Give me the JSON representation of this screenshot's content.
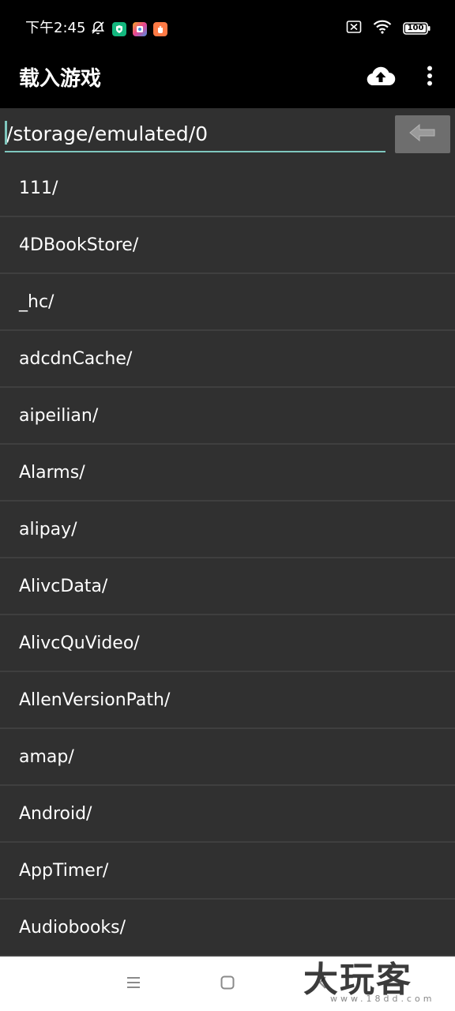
{
  "status_bar": {
    "time": "下午2:45",
    "battery": "100",
    "icons": [
      "mute-bell-icon",
      "security-app-icon",
      "gallery-app-icon",
      "orange-app-icon",
      "sim-off-icon",
      "wifi-icon",
      "battery-icon"
    ]
  },
  "app_bar": {
    "title": "载入游戏",
    "actions": [
      "cloud-upload-icon",
      "more-vert-icon"
    ]
  },
  "path_bar": {
    "path": "/storage/emulated/0",
    "back_icon": "arrow-left-icon"
  },
  "files": [
    "111/",
    "4DBookStore/",
    "_hc/",
    "adcdnCache/",
    "aipeilian/",
    "Alarms/",
    "alipay/",
    "AlivcData/",
    "AlivcQuVideo/",
    "AllenVersionPath/",
    "amap/",
    "Android/",
    "AppTimer/",
    "Audiobooks/"
  ],
  "nav_bar": {
    "buttons": [
      "menu-icon",
      "home-icon",
      "back-icon"
    ]
  },
  "watermark": {
    "text": "大玩客",
    "sub": "www.18dd.com"
  },
  "colors": {
    "background": "#303030",
    "accent": "#7fc7be",
    "divider": "#3f3f3f",
    "button_gray": "#6e6e6e"
  }
}
